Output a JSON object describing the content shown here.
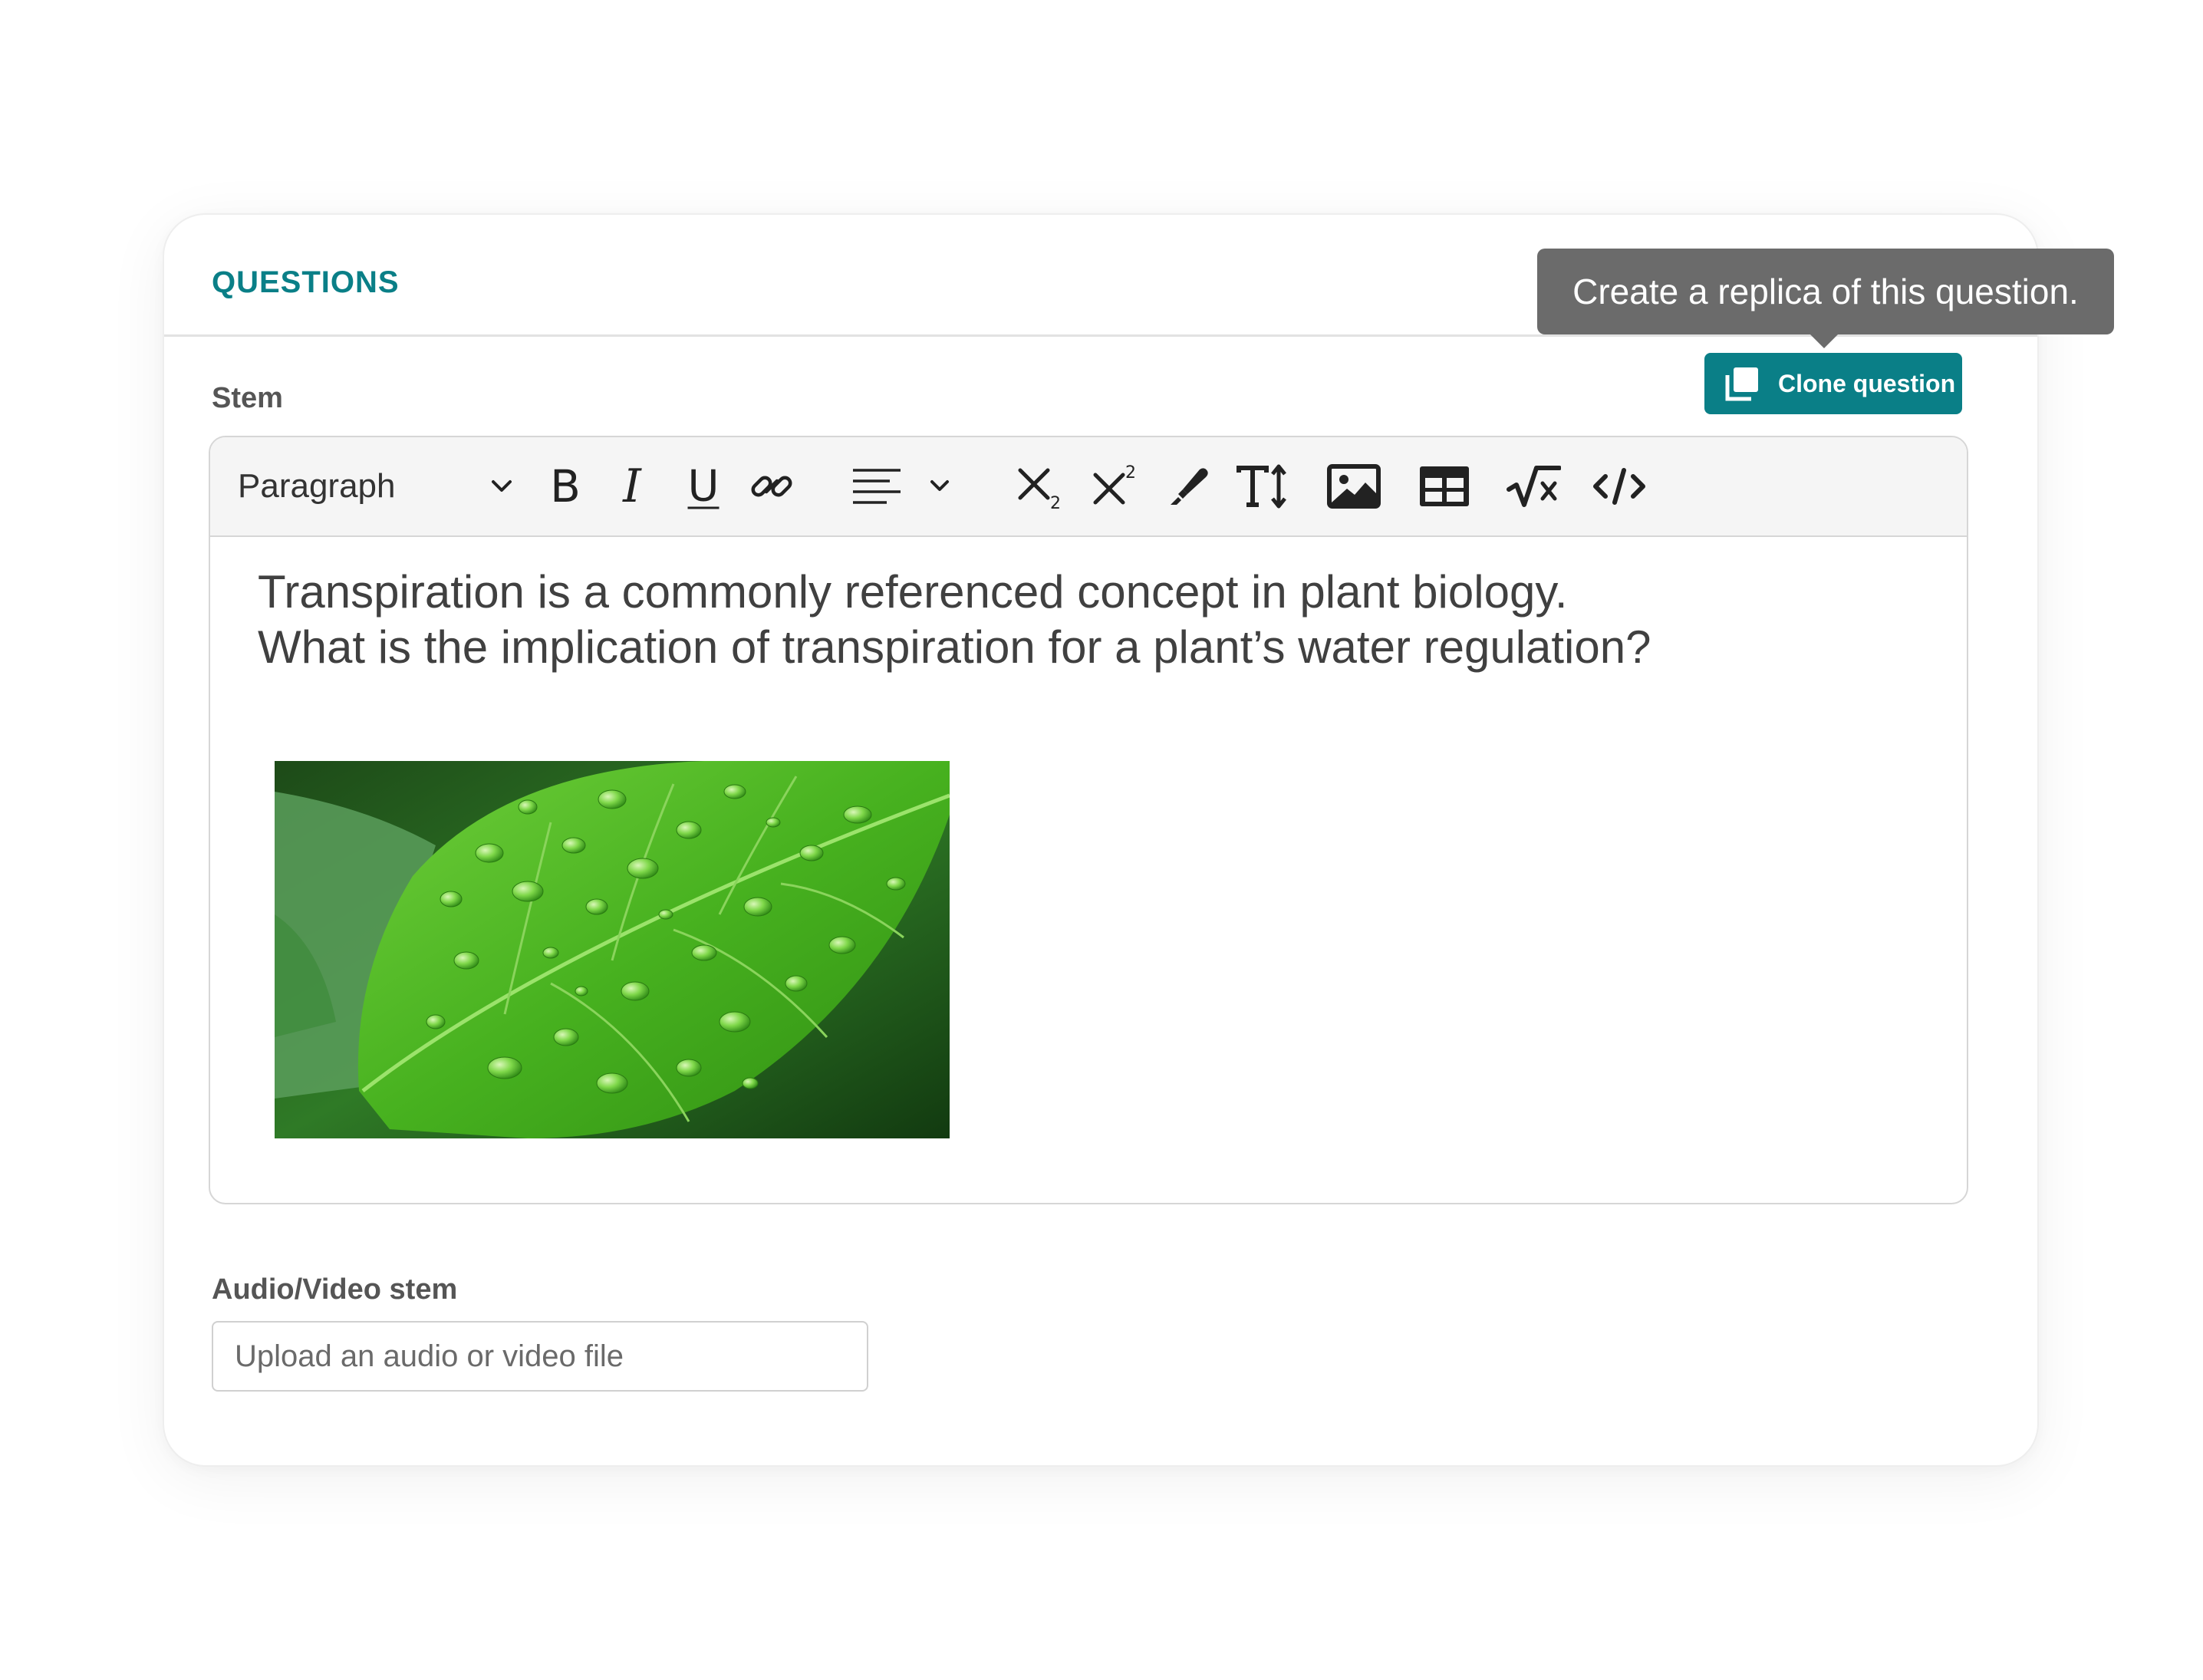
{
  "section": {
    "title": "QUESTIONS"
  },
  "tooltip": {
    "text": "Create a replica of this question."
  },
  "clone_button": {
    "label": "Clone question",
    "icon": "copy-icon",
    "color": "#0a7f87"
  },
  "stem": {
    "label": "Stem",
    "toolbar": {
      "block_format": "Paragraph",
      "icons": [
        "bold-icon",
        "italic-icon",
        "underline-icon",
        "link-icon",
        "align-left-icon",
        "subscript-icon",
        "superscript-icon",
        "highlight-icon",
        "font-size-icon",
        "image-icon",
        "table-icon",
        "math-icon",
        "code-icon"
      ]
    },
    "content": {
      "line1": "Transpiration is a commonly referenced concept in plant biology.",
      "line2": "What is the implication of transpiration for a plant’s water regulation?",
      "image": "leaf-with-water-drops"
    }
  },
  "av_stem": {
    "label": "Audio/Video stem",
    "upload_placeholder": "Upload an audio or video file",
    "upload_value": ""
  }
}
